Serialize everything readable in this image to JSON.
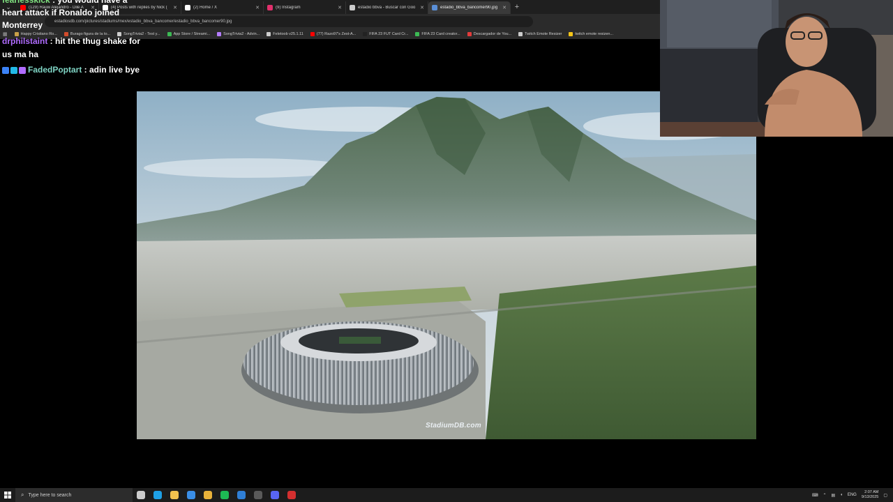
{
  "browser": {
    "tabs": [
      {
        "title": "(129) Rauw Alejandro - Dile A",
        "favicon_color": "#ff0000",
        "active": false
      },
      {
        "title": "(4) Posts with replies by Nick (",
        "favicon_color": "#ffffff",
        "active": false
      },
      {
        "title": "(2) Home / X",
        "favicon_color": "#ffffff",
        "active": false
      },
      {
        "title": "(9) Instagram",
        "favicon_color": "#e1306c",
        "active": false
      },
      {
        "title": "estadio bbva - Buscar con Goo",
        "favicon_color": "#cccccc",
        "active": false
      },
      {
        "title": "estadio_bbva_bancomer90.jpg",
        "favicon_color": "#5a8fd6",
        "active": true
      }
    ],
    "new_tab_label": "+",
    "close_label": "✕",
    "url": "estadiosdb.com/pictures/stadiums/mex/estadio_bbva_bancomer/estadio_bbva_bancomer90.jpg",
    "bookmarks": [
      {
        "label": "Happy Cristiano Ro...",
        "color": "#c8a048"
      },
      {
        "label": "Burago figura de la to...",
        "color": "#d24c2c"
      },
      {
        "label": "SongTrivia2 - Test y...",
        "color": "#cccccc"
      },
      {
        "label": "App Store / Streami...",
        "color": "#3cba54"
      },
      {
        "label": "SongTrivia2 - Advin...",
        "color": "#b47cff"
      },
      {
        "label": "Feletoob v25.1.11",
        "color": "#cccccc"
      },
      {
        "label": "(77) Razo97's Zest-A...",
        "color": "#ff0000"
      },
      {
        "label": "FIFA 23 FUT Card Cr...",
        "color": "#222222"
      },
      {
        "label": "FIFA 23 Card creator...",
        "color": "#3cba54"
      },
      {
        "label": "Descargador de You...",
        "color": "#e33b3b"
      },
      {
        "label": "Twitch Emote Resizer",
        "color": "#cccccc"
      },
      {
        "label": "twitch emote resizen...",
        "color": "#f5c518"
      }
    ]
  },
  "chat": {
    "messages": [
      {
        "user": "fearlesskick",
        "user_color": "#7fe07f",
        "text": " : you would have a",
        "badges": []
      },
      {
        "user": "",
        "user_color": "#ffffff",
        "text": "heart attack if Ronaldo joined",
        "badges": []
      },
      {
        "user": "",
        "user_color": "#ffffff",
        "text": "Monterrey",
        "badges": []
      },
      {
        "user": "drphilstaint",
        "user_color": "#b06cff",
        "text": " : hit the thug shake for",
        "badges": []
      },
      {
        "user": "",
        "user_color": "#ffffff",
        "text": "us ma ha",
        "badges": []
      },
      {
        "user": "FadedPoptart",
        "user_color": "#7fd4c4",
        "text": " : adin live bye",
        "badges": [
          "#3b82f6",
          "#22b8e6",
          "#b06cff"
        ]
      }
    ]
  },
  "image": {
    "watermark": "StadiumDB.com"
  },
  "taskbar": {
    "search_placeholder": "Type here to search",
    "apps": [
      {
        "name": "task-view",
        "color": "#cccccc"
      },
      {
        "name": "edge",
        "color": "#1ea0e6"
      },
      {
        "name": "file-explorer",
        "color": "#f2c14e"
      },
      {
        "name": "store",
        "color": "#3a8ee6"
      },
      {
        "name": "chrome",
        "color": "#e9b23a"
      },
      {
        "name": "spotify",
        "color": "#1db954"
      },
      {
        "name": "mail",
        "color": "#2f7fd6"
      },
      {
        "name": "obs",
        "color": "#5a5a5a"
      },
      {
        "name": "discord-like",
        "color": "#5865f2"
      },
      {
        "name": "opera",
        "color": "#d32f2f"
      }
    ],
    "language": "ENG",
    "time": "2:07 AM",
    "date": "9/13/2025"
  }
}
